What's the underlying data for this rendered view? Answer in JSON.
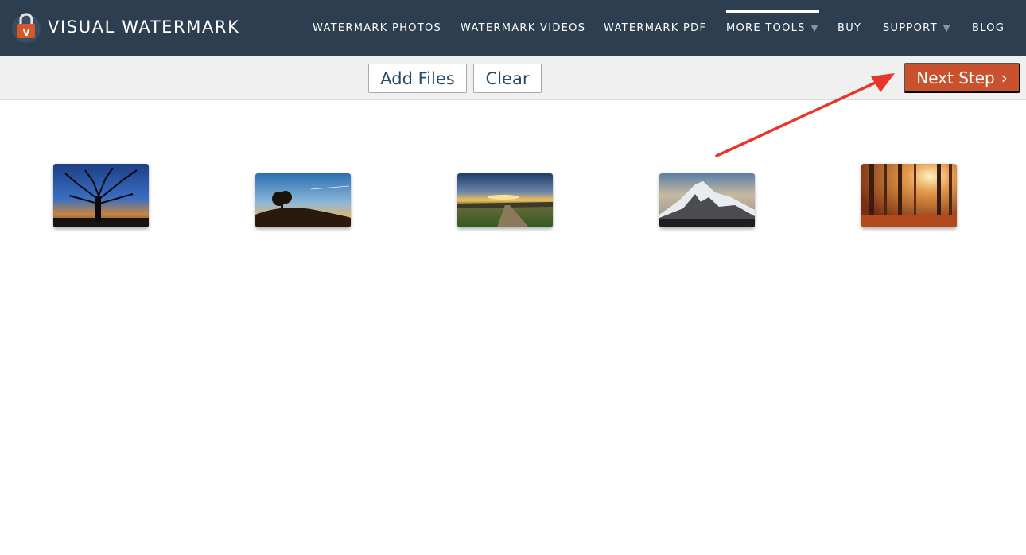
{
  "header": {
    "brand_name": "VISUAL WATERMARK",
    "brand_icon": "padlock-logo-icon",
    "brand_letter": "V",
    "nav": [
      {
        "label": "WATERMARK PHOTOS"
      },
      {
        "label": "WATERMARK VIDEOS"
      },
      {
        "label": "WATERMARK PDF"
      },
      {
        "label": "MORE TOOLS",
        "dropdown": true,
        "active": true
      },
      {
        "label": "BUY"
      },
      {
        "label": "SUPPORT",
        "dropdown": true
      },
      {
        "label": "BLOG"
      }
    ]
  },
  "toolbar": {
    "add_files_label": "Add Files",
    "clear_label": "Clear",
    "next_step_label": "Next Step"
  },
  "thumbnails": [
    {
      "subject": "tree-silhouette-sunset"
    },
    {
      "subject": "hill-tree-dusk"
    },
    {
      "subject": "sunset-field-road"
    },
    {
      "subject": "snowy-mountain"
    },
    {
      "subject": "autumn-forest-sunbeams"
    }
  ],
  "colors": {
    "nav_background": "#2d3e50",
    "next_button": "#c9512e",
    "toolbar_background": "#f0f0f0",
    "button_text": "#244b6a",
    "annotation_arrow": "#e8372a"
  }
}
